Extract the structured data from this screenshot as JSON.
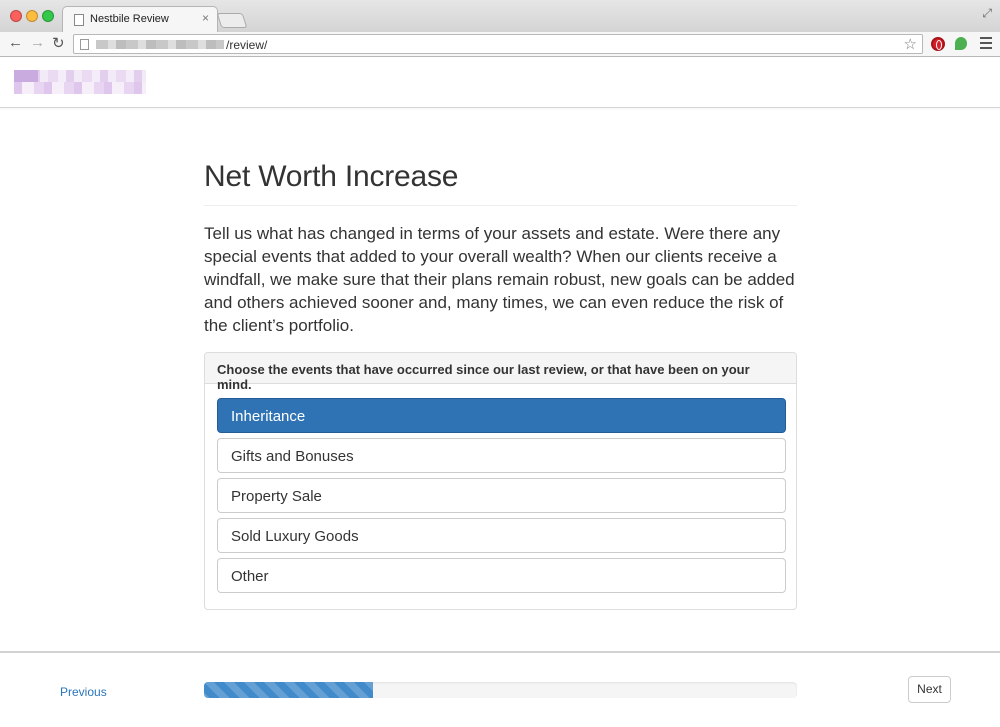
{
  "browser": {
    "tab_title": "Nestbile Review",
    "tab_close": "×",
    "url_path": "/review/",
    "star": "☆",
    "resize": "⤢"
  },
  "nav": {
    "back": "←",
    "forward": "→",
    "reload": "↻"
  },
  "page": {
    "title": "Net Worth Increase",
    "intro": "Tell us what has changed in terms of your assets and estate. Were there any special events that added to your overall wealth? When our clients receive a windfall, we make sure that their plans remain robust, new goals can be added and others achieved sooner and, many times, we can even reduce the risk of the client’s portfolio.",
    "panel_heading": "Choose the events that have occurred since our last review, or that have been on your mind.",
    "options": [
      {
        "label": "Inheritance",
        "selected": true
      },
      {
        "label": "Gifts and Bonuses",
        "selected": false
      },
      {
        "label": "Property Sale",
        "selected": false
      },
      {
        "label": "Sold Luxury Goods",
        "selected": false
      },
      {
        "label": "Other",
        "selected": false
      }
    ]
  },
  "footer": {
    "previous_label": "Previous",
    "next_label": "Next",
    "progress_fraction": 0.285
  },
  "colors": {
    "selected_option": "#2f73b5",
    "progress": "#428bca",
    "link": "#2a75bb"
  }
}
